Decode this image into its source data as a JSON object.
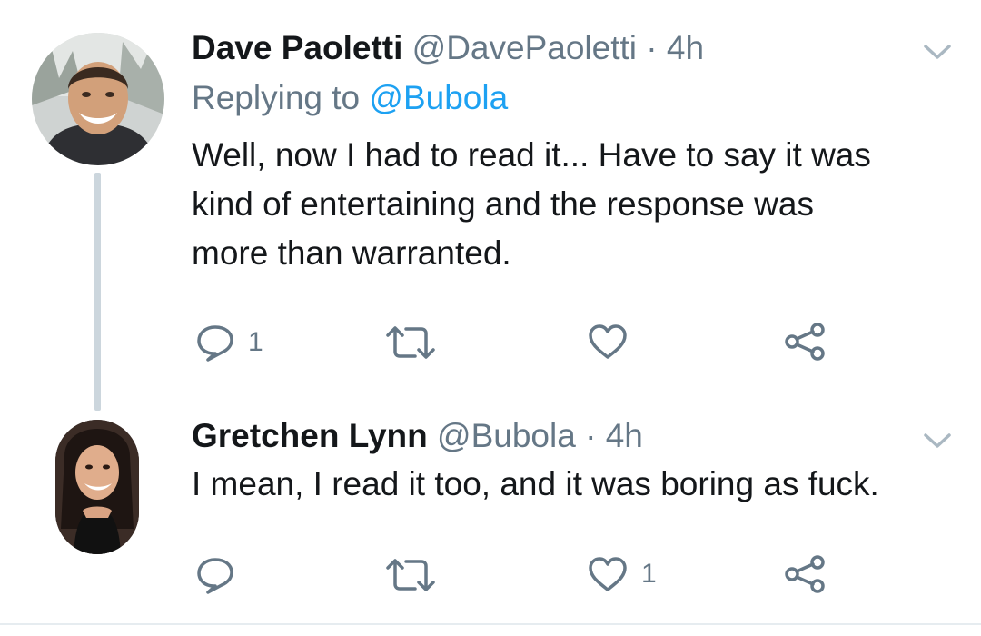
{
  "tweets": [
    {
      "display_name": "Dave Paoletti",
      "handle": "@DavePaoletti",
      "separator": "·",
      "time": "4h",
      "replying_prefix": "Replying to",
      "replying_to": "@Bubola",
      "text_lines": [
        "Well, now I had to read it... Have to say it was",
        "kind of entertaining and the response was",
        "more than warranted."
      ],
      "reply_count": "1",
      "retweet_count": "",
      "like_count": ""
    },
    {
      "display_name": "Gretchen Lynn",
      "handle": "@Bubola",
      "separator": "·",
      "time": "4h",
      "text_lines": [
        "I mean, I read it too, and it was boring as fuck."
      ],
      "reply_count": "",
      "retweet_count": "",
      "like_count": "1"
    }
  ],
  "icons": {
    "reply": "reply-icon",
    "retweet": "retweet-icon",
    "like": "heart-icon",
    "share": "share-icon",
    "menu": "chevron-down-icon"
  },
  "colors": {
    "name": "#14171a",
    "secondary": "#657786",
    "link": "#1da1f2",
    "thread_line": "#ccd6dd"
  }
}
